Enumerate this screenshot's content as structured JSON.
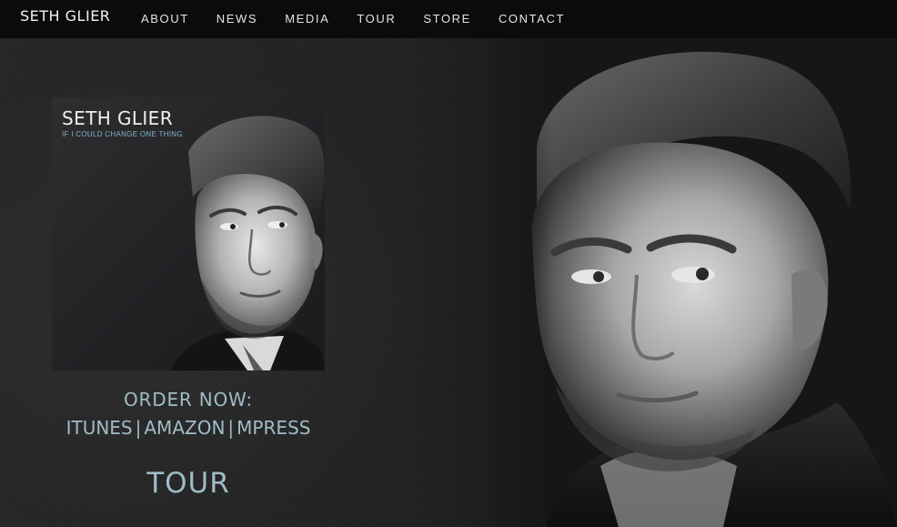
{
  "nav": {
    "brand": "SETH GLIER",
    "links": [
      "ABOUT",
      "NEWS",
      "MEDIA",
      "TOUR",
      "STORE",
      "CONTACT"
    ]
  },
  "album": {
    "artist": "SETH GLIER",
    "title": "IF I COULD CHANGE ONE THING"
  },
  "order": {
    "heading": "ORDER NOW:",
    "stores": [
      "ITUNES",
      "AMAZON",
      "MPRESS"
    ],
    "separator": "|"
  },
  "tour_link": "TOUR",
  "colors": {
    "nav_background": "#0b0b0b",
    "accent_text": "#9fbcc6",
    "album_subtitle": "#7fb4c8"
  }
}
